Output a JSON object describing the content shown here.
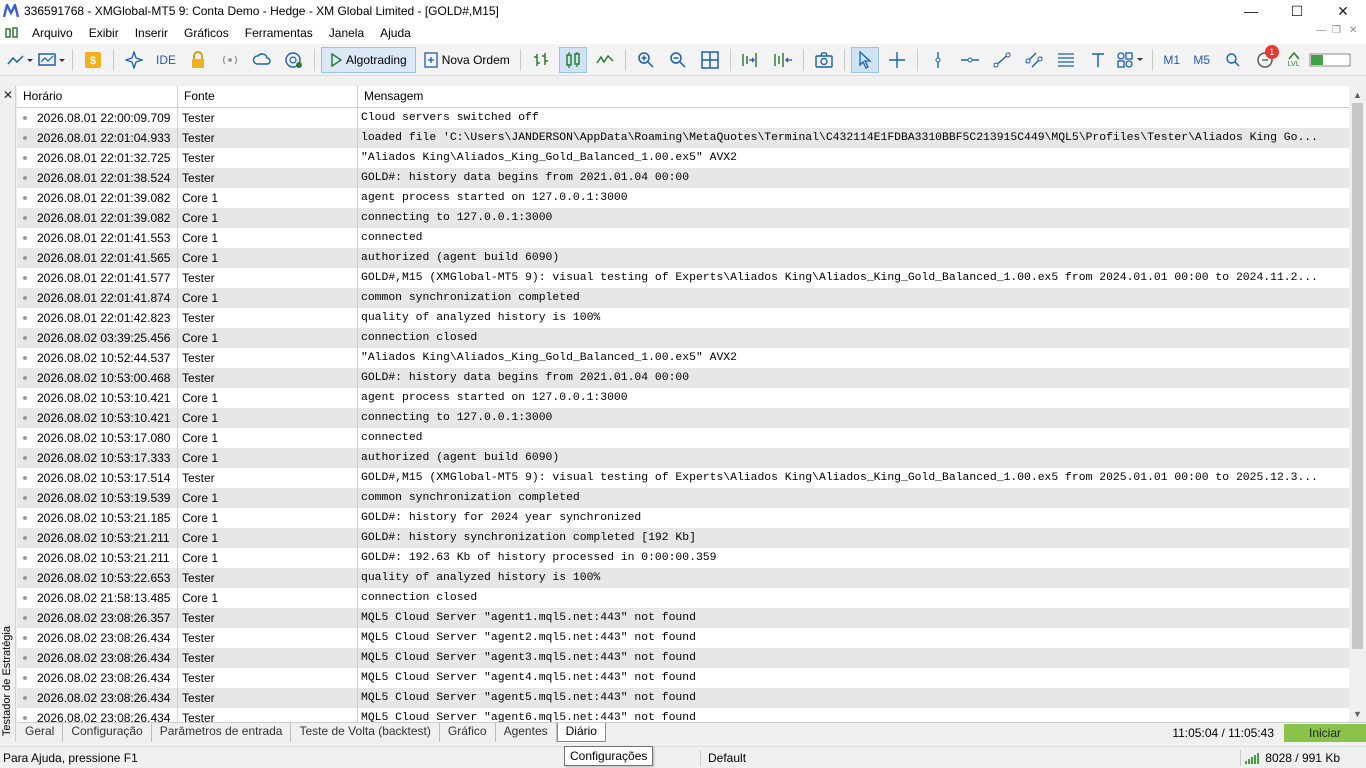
{
  "window": {
    "title": "336591768 - XMGlobal-MT5 9: Conta Demo - Hedge - XM Global Limited - [GOLD#,M15]",
    "minimize": "—",
    "maximize": "☐",
    "close": "✕"
  },
  "menu": [
    "Arquivo",
    "Exibir",
    "Inserir",
    "Gráficos",
    "Ferramentas",
    "Janela",
    "Ajuda"
  ],
  "toolbar": {
    "ide_label": "IDE",
    "algotrading_label": "Algotrading",
    "new_order_label": "Nova Ordem",
    "timeframes": [
      "M1",
      "M5"
    ],
    "notification_count": "1",
    "level_label": "LVL"
  },
  "side_panel": {
    "close": "✕",
    "title": "Testador de Estratégia"
  },
  "log": {
    "columns": [
      "Horário",
      "Fonte",
      "Mensagem"
    ],
    "rows": [
      {
        "time": "2026.08.01 22:00:09.709",
        "source": "Tester",
        "message": "Cloud servers switched off"
      },
      {
        "time": "2026.08.01 22:01:04.933",
        "source": "Tester",
        "message": "loaded file 'C:\\Users\\JANDERSON\\AppData\\Roaming\\MetaQuotes\\Terminal\\C432114E1FDBA3310BBF5C213915C449\\MQL5\\Profiles\\Tester\\Aliados King Go..."
      },
      {
        "time": "2026.08.01 22:01:32.725",
        "source": "Tester",
        "message": "\"Aliados King\\Aliados_King_Gold_Balanced_1.00.ex5\" AVX2"
      },
      {
        "time": "2026.08.01 22:01:38.524",
        "source": "Tester",
        "message": "GOLD#: history data begins from 2021.01.04 00:00"
      },
      {
        "time": "2026.08.01 22:01:39.082",
        "source": "Core 1",
        "message": "agent process started on 127.0.0.1:3000"
      },
      {
        "time": "2026.08.01 22:01:39.082",
        "source": "Core 1",
        "message": "connecting to 127.0.0.1:3000"
      },
      {
        "time": "2026.08.01 22:01:41.553",
        "source": "Core 1",
        "message": "connected"
      },
      {
        "time": "2026.08.01 22:01:41.565",
        "source": "Core 1",
        "message": "authorized (agent build 6090)"
      },
      {
        "time": "2026.08.01 22:01:41.577",
        "source": "Tester",
        "message": "GOLD#,M15 (XMGlobal-MT5 9): visual testing of Experts\\Aliados King\\Aliados_King_Gold_Balanced_1.00.ex5 from 2024.01.01 00:00 to 2024.11.2..."
      },
      {
        "time": "2026.08.01 22:01:41.874",
        "source": "Core 1",
        "message": "common synchronization completed"
      },
      {
        "time": "2026.08.01 22:01:42.823",
        "source": "Tester",
        "message": "quality of analyzed history is 100%"
      },
      {
        "time": "2026.08.02 03:39:25.456",
        "source": "Core 1",
        "message": "connection closed"
      },
      {
        "time": "2026.08.02 10:52:44.537",
        "source": "Tester",
        "message": "\"Aliados King\\Aliados_King_Gold_Balanced_1.00.ex5\" AVX2"
      },
      {
        "time": "2026.08.02 10:53:00.468",
        "source": "Tester",
        "message": "GOLD#: history data begins from 2021.01.04 00:00"
      },
      {
        "time": "2026.08.02 10:53:10.421",
        "source": "Core 1",
        "message": "agent process started on 127.0.0.1:3000"
      },
      {
        "time": "2026.08.02 10:53:10.421",
        "source": "Core 1",
        "message": "connecting to 127.0.0.1:3000"
      },
      {
        "time": "2026.08.02 10:53:17.080",
        "source": "Core 1",
        "message": "connected"
      },
      {
        "time": "2026.08.02 10:53:17.333",
        "source": "Core 1",
        "message": "authorized (agent build 6090)"
      },
      {
        "time": "2026.08.02 10:53:17.514",
        "source": "Tester",
        "message": "GOLD#,M15 (XMGlobal-MT5 9): visual testing of Experts\\Aliados King\\Aliados_King_Gold_Balanced_1.00.ex5 from 2025.01.01 00:00 to 2025.12.3..."
      },
      {
        "time": "2026.08.02 10:53:19.539",
        "source": "Core 1",
        "message": "common synchronization completed"
      },
      {
        "time": "2026.08.02 10:53:21.185",
        "source": "Core 1",
        "message": "GOLD#: history for 2024 year synchronized"
      },
      {
        "time": "2026.08.02 10:53:21.211",
        "source": "Core 1",
        "message": "GOLD#: history synchronization completed [192 Kb]"
      },
      {
        "time": "2026.08.02 10:53:21.211",
        "source": "Core 1",
        "message": "GOLD#: 192.63 Kb of history processed in 0:00:00.359"
      },
      {
        "time": "2026.08.02 10:53:22.653",
        "source": "Tester",
        "message": "quality of analyzed history is 100%"
      },
      {
        "time": "2026.08.02 21:58:13.485",
        "source": "Core 1",
        "message": "connection closed"
      },
      {
        "time": "2026.08.02 23:08:26.357",
        "source": "Tester",
        "message": "MQL5 Cloud Server \"agent1.mql5.net:443\" not found"
      },
      {
        "time": "2026.08.02 23:08:26.434",
        "source": "Tester",
        "message": "MQL5 Cloud Server \"agent2.mql5.net:443\" not found"
      },
      {
        "time": "2026.08.02 23:08:26.434",
        "source": "Tester",
        "message": "MQL5 Cloud Server \"agent3.mql5.net:443\" not found"
      },
      {
        "time": "2026.08.02 23:08:26.434",
        "source": "Tester",
        "message": "MQL5 Cloud Server \"agent4.mql5.net:443\" not found"
      },
      {
        "time": "2026.08.02 23:08:26.434",
        "source": "Tester",
        "message": "MQL5 Cloud Server \"agent5.mql5.net:443\" not found"
      },
      {
        "time": "2026.08.02 23:08:26.434",
        "source": "Tester",
        "message": "MQL5 Cloud Server \"agent6.mql5.net:443\" not found"
      }
    ]
  },
  "tabs": [
    "Geral",
    "Configuração",
    "Parâmetros de entrada",
    "Teste de Volta (backtest)",
    "Gráfico",
    "Agentes",
    "Diário"
  ],
  "active_tab": "Diário",
  "tab_time": "11:05:04 / 11:05:43",
  "start_button": "Iniciar",
  "status": {
    "help": "Para Ajuda, pressione F1",
    "profile": "Default",
    "traffic": "8028 / 991 Kb"
  },
  "tooltip": "Configurações",
  "colors": {
    "accent": "#1a5fb4",
    "start_button": "#8bc34a",
    "row_alt": "#e7e7e7",
    "badge": "#e53935"
  }
}
